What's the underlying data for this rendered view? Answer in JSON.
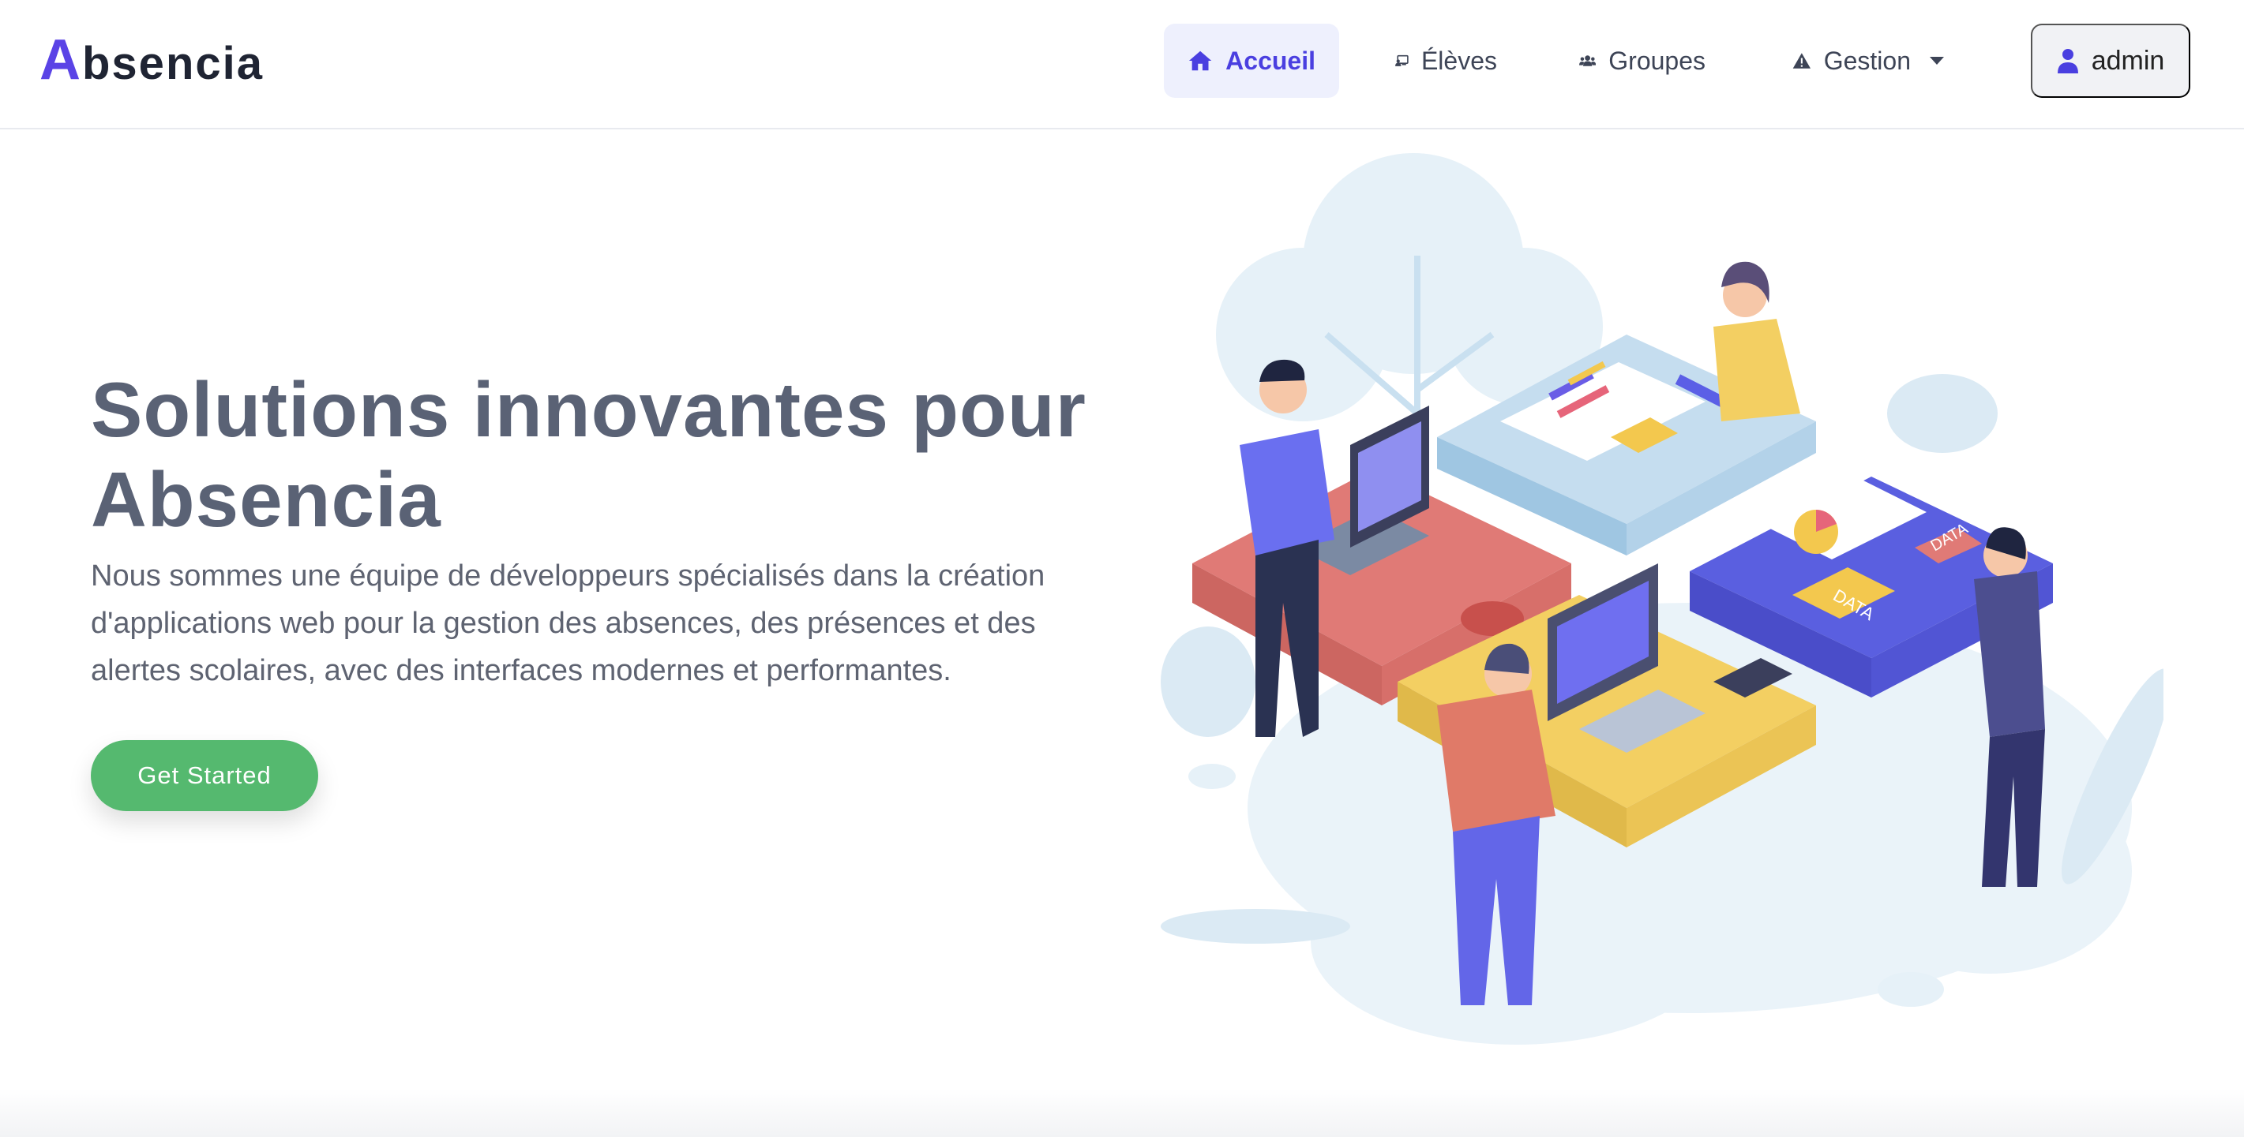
{
  "brand": {
    "initial": "A",
    "rest": "bsencia",
    "accent": "#5a43e6"
  },
  "nav": {
    "items": [
      {
        "label": "Accueil",
        "icon": "home-icon",
        "active": true
      },
      {
        "label": "Élèves",
        "icon": "chalkboard-teacher-icon",
        "active": false
      },
      {
        "label": "Groupes",
        "icon": "users-icon",
        "active": false
      },
      {
        "label": "Gestion",
        "icon": "warning-icon",
        "active": false,
        "dropdown": true
      }
    ],
    "user": {
      "label": "admin",
      "icon": "user-icon"
    }
  },
  "hero": {
    "title": "Solutions innovantes pour Absencia",
    "description": "Nous sommes une équipe de développeurs spécialisés dans la création d'applications web pour la gestion des absences, des présences et des alertes scolaires, avec des interfaces modernes et performantes.",
    "cta": "Get Started",
    "illustration_labels": [
      "DATA",
      "DATA"
    ]
  },
  "colors": {
    "cta": "#55b96f",
    "active_nav_bg": "#eef0fd",
    "active_nav_text": "#4a3fe0",
    "title": "#5a6275"
  }
}
